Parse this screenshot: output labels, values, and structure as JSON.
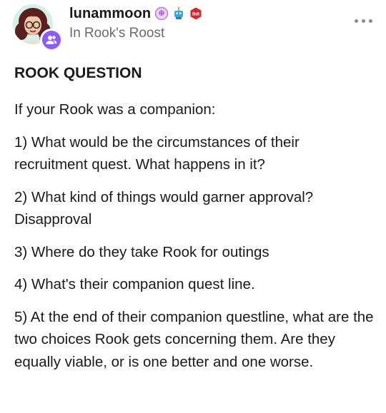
{
  "post": {
    "username": "lunammoon",
    "community_prefix": "In",
    "community_name": "Rook's Roost",
    "badge_text": "Bdt",
    "title": "ROOK QUESTION",
    "paragraphs": [
      "If your Rook was a companion:",
      "1) What would be the circumstances of their recruitment quest. What happens in it?",
      "2) What kind of things would garner approval? Disapproval",
      "3) Where do they take Rook for outings",
      "4) What's their companion quest line.",
      "5) At the end of their companion questline, what are the two choices Rook gets concerning them. Are they equally viable, or is one better and one worse."
    ]
  },
  "icons": {
    "avatar": "user-avatar",
    "community": "group-icon",
    "badge_1": "brain-badge-icon",
    "badge_2": "robot-badge-icon",
    "badge_3": "hexagon-badge-icon",
    "more": "more-options-icon"
  },
  "colors": {
    "community_badge": "#8b5cf6",
    "text_primary": "#1a1a1a",
    "text_secondary": "#6b6b6b",
    "badge_brain": "#b57bd9",
    "badge_robot": "#3aa6d9",
    "badge_hexagon": "#d3262f"
  }
}
